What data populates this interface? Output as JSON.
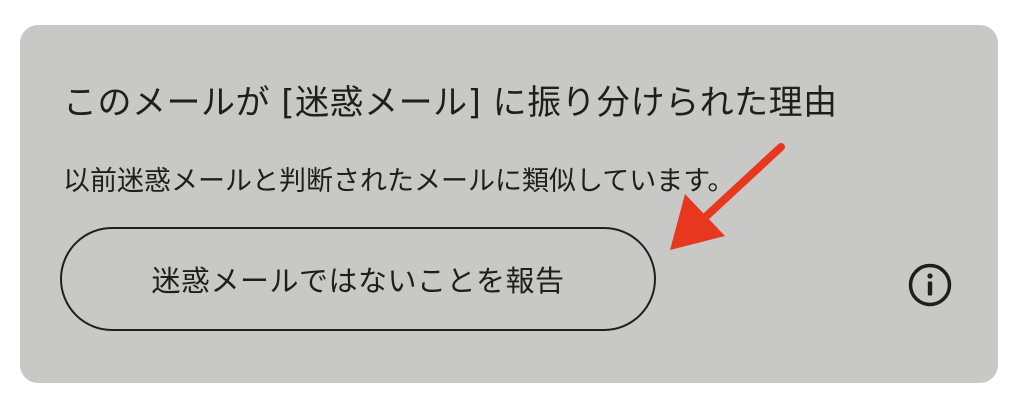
{
  "dialog": {
    "title": "このメールが [迷惑メール] に振り分けられた理由",
    "description": "以前迷惑メールと判断されたメールに類似しています。",
    "report_button_label": "迷惑メールではないことを報告",
    "info_icon": "info-circle-icon"
  },
  "annotation": {
    "arrow_color": "#e8371f"
  },
  "colors": {
    "card_background": "#c8c9c7",
    "text": "#1e1e1e"
  }
}
